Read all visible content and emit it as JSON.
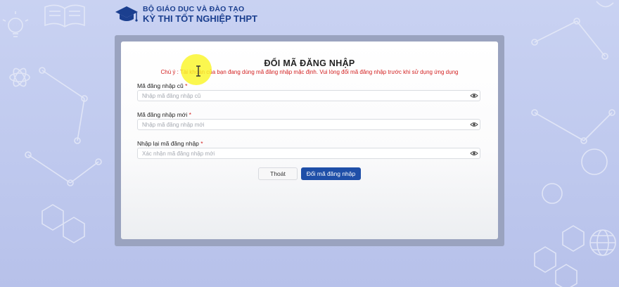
{
  "header": {
    "org_name": "BỘ GIÁO DỤC VÀ ĐÀO TẠO",
    "exam_name": "KỲ THI TỐT NGHIỆP THPT"
  },
  "dialog": {
    "title": "ĐỔI MÃ ĐĂNG NHẬP",
    "notice": "Chú ý : Tài khoản của bạn đang dùng mã đăng nhập mặc định. Vui lòng đổi mã đăng nhập trước khi sử dụng ứng dụng",
    "fields": [
      {
        "label": "Mã đăng nhập cũ",
        "required_mark": "*",
        "placeholder": "Nhập mã đăng nhập cũ",
        "value": ""
      },
      {
        "label": "Mã đăng nhập mới",
        "required_mark": "*",
        "placeholder": "Nhập mã đăng nhập mới",
        "value": ""
      },
      {
        "label": "Nhập lại mã đăng nhập",
        "required_mark": "*",
        "placeholder": "Xác nhận mã đăng nhập mới",
        "value": ""
      }
    ],
    "buttons": {
      "exit_label": "Thoát",
      "submit_label": "Đổi mã đăng nhập"
    }
  },
  "colors": {
    "brand_blue": "#1b3f8f",
    "primary_button": "#1f4fa8",
    "warning_red": "#d32020",
    "cursor_highlight": "#faf528"
  },
  "icons": {
    "logo": "graduation-cap-icon",
    "password_toggle": "eye-icon",
    "pointer": "text-cursor-icon"
  }
}
